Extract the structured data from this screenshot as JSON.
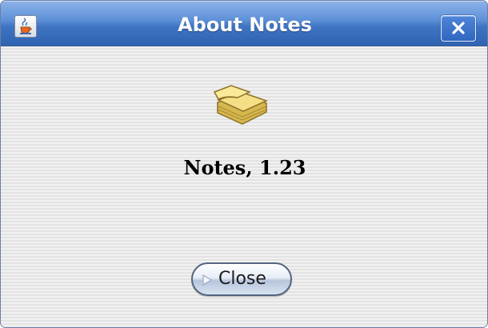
{
  "window": {
    "title": "About Notes"
  },
  "icons": {
    "app": "java-coffee-cup-icon",
    "close": "close-icon",
    "product": "notes-pad-icon",
    "button_arrow": "play-arrow-icon"
  },
  "main": {
    "version_text": "Notes, 1.23"
  },
  "actions": {
    "close_label": "Close"
  },
  "colors": {
    "titlebar": "#4a7dcc",
    "titlebar_text": "#ffffff",
    "dialog_bg": "#ebebeb",
    "notepad": "#f0d778"
  }
}
